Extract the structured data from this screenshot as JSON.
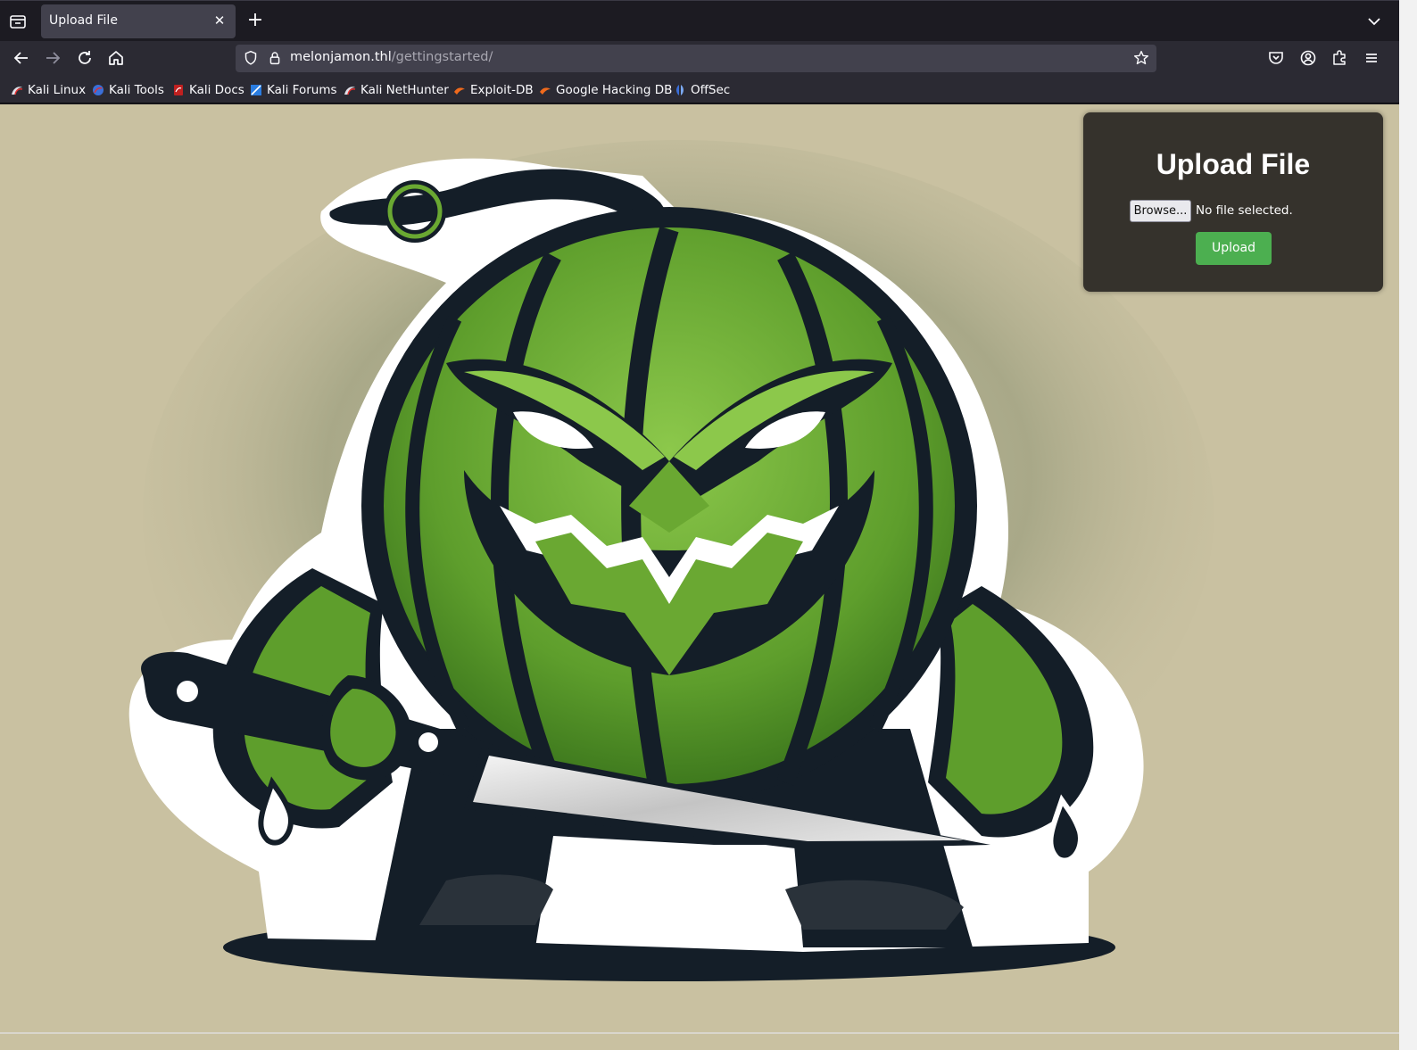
{
  "tab": {
    "title": "Upload File"
  },
  "nav": {
    "url_host": "melonjamon.thl",
    "url_path": "/gettingstarted/"
  },
  "bookmarks": [
    {
      "label": "Kali Linux",
      "icon": "kali-dragon-icon"
    },
    {
      "label": "Kali Tools",
      "icon": "kali-tools-icon"
    },
    {
      "label": "Kali Docs",
      "icon": "kali-docs-icon"
    },
    {
      "label": "Kali Forums",
      "icon": "kali-forums-icon"
    },
    {
      "label": "Kali NetHunter",
      "icon": "kali-dragon-icon"
    },
    {
      "label": "Exploit-DB",
      "icon": "exploit-db-icon"
    },
    {
      "label": "Google Hacking DB",
      "icon": "exploit-db-icon"
    },
    {
      "label": "OffSec",
      "icon": "offsec-icon"
    }
  ],
  "upload": {
    "title": "Upload File",
    "browse_label": "Browse...",
    "file_status": "No file selected.",
    "submit_label": "Upload"
  },
  "colors": {
    "page_bg": "#c9c1a1",
    "panel_bg": "#35322c",
    "upload_button": "#4caf50",
    "melon_green": "#6aa832",
    "outline": "#141e28"
  }
}
